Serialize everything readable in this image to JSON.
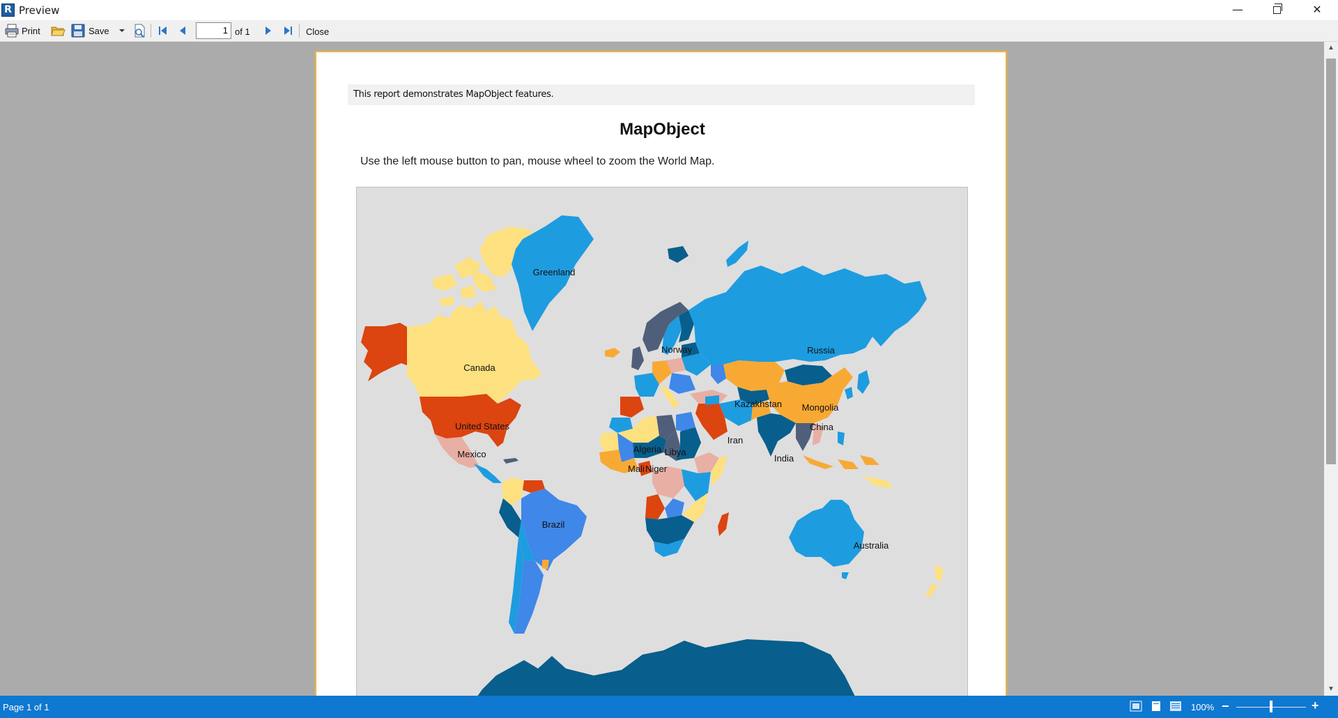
{
  "window": {
    "title": "Preview",
    "app_icon_letter": "R",
    "controls": {
      "minimize": "—",
      "maximize": "restore",
      "close": "✕"
    }
  },
  "toolbar": {
    "print_label": "Print",
    "save_label": "Save",
    "page_value": "1",
    "page_of": "of 1",
    "close_label": "Close"
  },
  "report": {
    "note": "This report demonstrates MapObject features.",
    "title": "MapObject",
    "instruction": "Use the left mouse button to pan, mouse wheel to zoom the World Map."
  },
  "map": {
    "background": "#dedede",
    "labels": [
      "Greenland",
      "Canada",
      "United States",
      "Mexico",
      "Brazil",
      "Norway",
      "Russia",
      "Kazakhstan",
      "Mongolia",
      "China",
      "Iran",
      "India",
      "Algeria",
      "Libya",
      "Mali",
      "Niger",
      "Australia"
    ],
    "colors": {
      "blue": "#1e9ce0",
      "dark_blue": "#085e8c",
      "slate": "#4f5f7a",
      "pale_yellow": "#fde080",
      "orange": "#f8a934",
      "red_orange": "#dc4410",
      "pink": "#e8afa4",
      "royal_blue": "#3f87e9"
    }
  },
  "statusbar": {
    "page_text": "Page 1 of 1",
    "zoom": "100%",
    "zoom_level": 0.5,
    "zoom_minus": "−",
    "zoom_plus": "+"
  }
}
